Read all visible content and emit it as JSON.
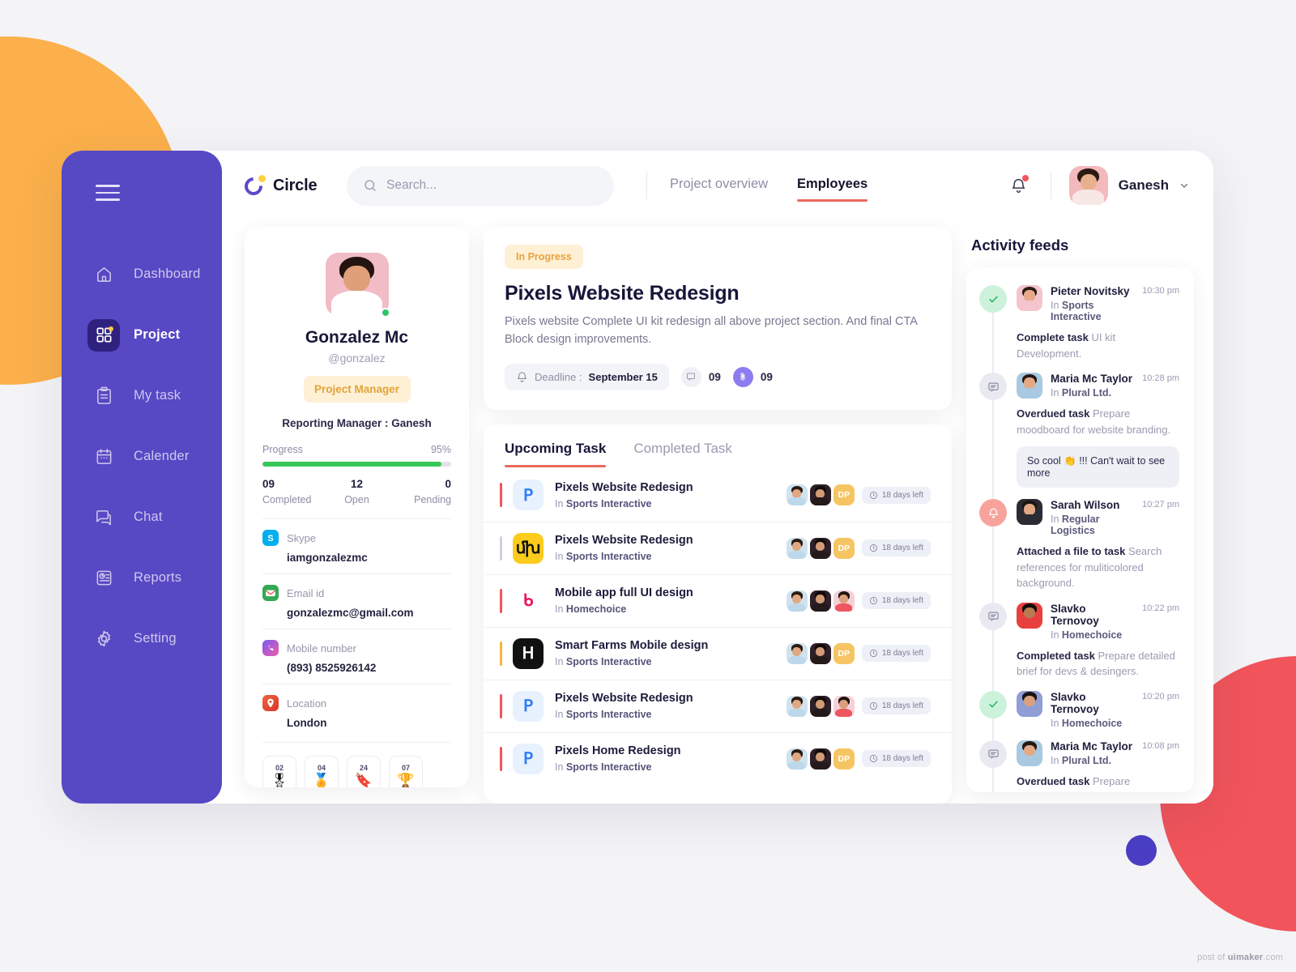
{
  "app": {
    "logo_text": "Circle"
  },
  "search": {
    "placeholder": "Search...",
    "value": ""
  },
  "topnav": {
    "tabs": [
      {
        "label": "Project overview",
        "active": false
      },
      {
        "label": "Employees",
        "active": true
      }
    ],
    "user_name": "Ganesh",
    "notification_badge": true
  },
  "sidebar": {
    "items": [
      {
        "label": "Dashboard",
        "icon": "home-icon",
        "active": false
      },
      {
        "label": "Project",
        "icon": "grid-icon",
        "active": true
      },
      {
        "label": "My task",
        "icon": "clipboard-icon",
        "active": false
      },
      {
        "label": "Calender",
        "icon": "calendar-icon",
        "active": false
      },
      {
        "label": "Chat",
        "icon": "chat-icon",
        "active": false
      },
      {
        "label": "Reports",
        "icon": "report-icon",
        "active": false
      },
      {
        "label": "Setting",
        "icon": "gear-icon",
        "active": false
      }
    ]
  },
  "profile": {
    "name": "Gonzalez Mc",
    "handle": "@gonzalez",
    "role": "Project Manager",
    "reporting_manager": "Reporting Manager : Ganesh",
    "progress_label": "Progress",
    "progress_value": "95%",
    "progress_percent": 95,
    "stats": [
      {
        "value": "09",
        "label": "Completed"
      },
      {
        "value": "12",
        "label": "Open"
      },
      {
        "value": "0",
        "label": "Pending"
      }
    ],
    "contacts": [
      {
        "icon": "skype-icon",
        "label": "Skype",
        "value": "iamgonzalezmc",
        "color": "#00aff0"
      },
      {
        "icon": "email-icon",
        "label": "Email id",
        "value": "gonzalezmc@gmail.com",
        "color": "#34a853"
      },
      {
        "icon": "phone-icon",
        "label": "Mobile number",
        "value": "(893) 8525926142",
        "color": "#7b5cf0"
      },
      {
        "icon": "location-icon",
        "label": "Location",
        "value": "London",
        "color": "#e8522f"
      }
    ],
    "awards": [
      {
        "count": "02",
        "glyph": "🎖",
        "name": "medal-badge"
      },
      {
        "count": "04",
        "glyph": "🏅",
        "name": "rosette-badge"
      },
      {
        "count": "24",
        "glyph": "🔖",
        "name": "bookmark-badge"
      },
      {
        "count": "07",
        "glyph": "🏆",
        "name": "trophy-badge"
      }
    ]
  },
  "project": {
    "status": "In Progress",
    "title": "Pixels Website Redesign",
    "description": "Pixels website Complete UI kit redesign all above project section. And final CTA Block design improvements.",
    "deadline_label": "Deadline :",
    "deadline_value": "September 15",
    "comments_count": "09",
    "attachments_count": "09"
  },
  "tasks": {
    "tabs": [
      {
        "label": "Upcoming Task",
        "active": true
      },
      {
        "label": "Completed Task",
        "active": false
      }
    ],
    "items": [
      {
        "name": "Pixels Website Redesign",
        "in_label": "In",
        "project": "Sports Interactive",
        "days": "18 days left",
        "bar": "#f2545b",
        "icon_bg": "#e8f1fe",
        "icon_fg": "#2e7df6",
        "icon_glyph": "ꓑ",
        "members": [
          "DP"
        ]
      },
      {
        "name": "Pixels Website Redesign",
        "in_label": "In",
        "project": "Sports Interactive",
        "days": "18 days left",
        "bar": "#cfd3dd",
        "icon_bg": "#fbcc1b",
        "icon_fg": "#121212",
        "icon_glyph": "ﬗ",
        "members": [
          "DP"
        ]
      },
      {
        "name": "Mobile app full UI design",
        "in_label": "In",
        "project": "Homechoice",
        "days": "18 days left",
        "bar": "#f2545b",
        "icon_bg": "#ffffff",
        "icon_fg": "#e8145b",
        "icon_glyph": "ᑲ",
        "members": []
      },
      {
        "name": "Smart Farms Mobile design",
        "in_label": "In",
        "project": "Sports Interactive",
        "days": "18 days left",
        "bar": "#f4b63f",
        "icon_bg": "#111111",
        "icon_fg": "#ffffff",
        "icon_glyph": "ᕼ",
        "members": [
          "DP"
        ]
      },
      {
        "name": "Pixels Website Redesign",
        "in_label": "In",
        "project": "Sports Interactive",
        "days": "18 days left",
        "bar": "#f2545b",
        "icon_bg": "#e8f1fe",
        "icon_fg": "#2e7df6",
        "icon_glyph": "ꓑ",
        "members": []
      },
      {
        "name": "Pixels Home Redesign",
        "in_label": "In",
        "project": "Sports Interactive",
        "days": "18 days left",
        "bar": "#f2545b",
        "icon_bg": "#e8f1fe",
        "icon_fg": "#2e7df6",
        "icon_glyph": "ꓑ",
        "members": [
          "DP"
        ]
      }
    ]
  },
  "activity": {
    "title": "Activity feeds",
    "items": [
      {
        "mark": "check",
        "name": "Pieter Novitsky",
        "in_label": "In",
        "project": "Sports Interactive",
        "time": "10:30 pm",
        "action": "Complete task",
        "detail": "UI kit Development.",
        "reply": null,
        "hair": "#2a1b14",
        "skin": "#e8a98a",
        "body": "#f4c5cd"
      },
      {
        "mark": "chat",
        "name": "Maria Mc Taylor",
        "in_label": "In",
        "project": "Plural Ltd.",
        "time": "10:28 pm",
        "action": "Overdued task",
        "detail": "Prepare moodboard for website branding.",
        "reply": "So cool 👏 !!! Can't wait to see more",
        "hair": "#241813",
        "skin": "#e3a985",
        "body": "#a9c9e2"
      },
      {
        "mark": "bell",
        "name": "Sarah Wilson",
        "in_label": "In",
        "project": "Regular Logistics",
        "time": "10:27 pm",
        "action": "Attached a file to task",
        "detail": "Search references for muliticolored background.",
        "reply": null,
        "hair": "#1d1410",
        "skin": "#e2a784",
        "body": "#2b2b33"
      },
      {
        "mark": "chat",
        "name": "Slavko Ternovoy",
        "in_label": "In",
        "project": "Homechoice",
        "time": "10:22 pm",
        "action": "Completed task",
        "detail": "Prepare detailed brief for devs & desingers.",
        "reply": null,
        "hair": "#120d0a",
        "skin": "#b97c52",
        "body": "#e8403f"
      },
      {
        "mark": "check",
        "name": "Slavko Ternovoy",
        "in_label": "In",
        "project": "Homechoice",
        "time": "10:20 pm",
        "action": "",
        "detail": "",
        "reply": null,
        "hair": "#1a1210",
        "skin": "#d9a07d",
        "body": "#8f9ed4"
      },
      {
        "mark": "chat",
        "name": "Maria Mc Taylor",
        "in_label": "In",
        "project": "Plural Ltd.",
        "time": "10:08 pm",
        "action": "Overdued task",
        "detail": "Prepare moodboard for website branding.",
        "reply": null,
        "hair": "#241813",
        "skin": "#e3a985",
        "body": "#a9c9e2"
      }
    ]
  },
  "footer": {
    "watermark_prefix": "post of ",
    "watermark_brand": "uimaker",
    "watermark_suffix": ".com"
  },
  "colors": {
    "sidebar": "#5748c4",
    "accent_red": "#ea6a5e",
    "accent_orange": "#fbb04b",
    "accent_purple": "#4a3fc4",
    "progress_green": "#35c759"
  }
}
